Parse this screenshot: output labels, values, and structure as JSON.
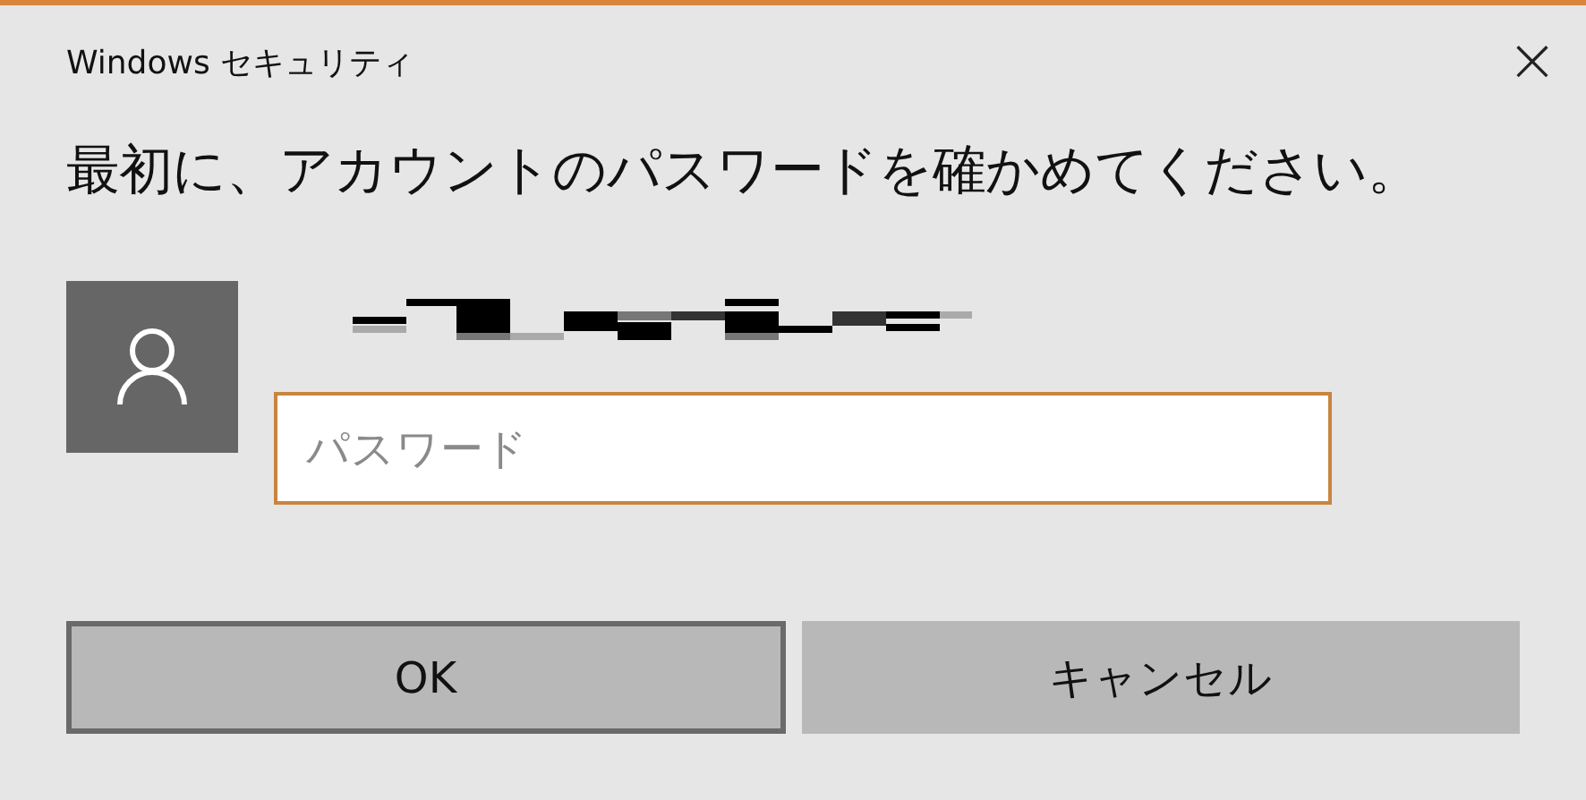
{
  "window": {
    "title": "Windows セキュリティ",
    "close": "×"
  },
  "heading": "最初に、アカウントのパスワードを確かめてください。",
  "password_field": {
    "placeholder": "パスワード",
    "focused": true
  },
  "buttons": [
    {
      "label": "OK",
      "default": true
    },
    {
      "label": "キャンセル",
      "default": false
    }
  ]
}
